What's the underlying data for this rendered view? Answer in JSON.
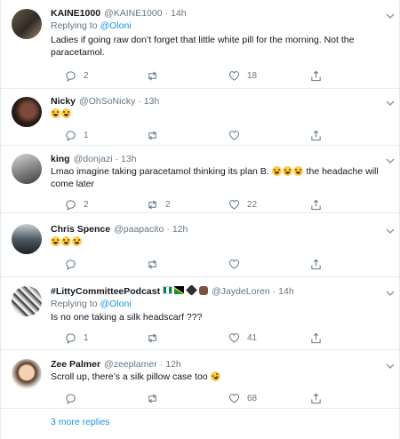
{
  "tweets": [
    {
      "name": "KAINE1000",
      "handle": "@KAINE1000",
      "time": "14h",
      "replying_label": "Replying to ",
      "replying_to": "@Oloni",
      "text": "Ladies if going raw don’t forget that little white pill for the morning. Not the paracetamol.",
      "replies": "2",
      "retweets": "",
      "likes": "18"
    },
    {
      "name": "Nicky",
      "handle": "@OhSoNicky",
      "time": "13h",
      "text": "",
      "emoji_count": 2,
      "replies": "1",
      "retweets": "",
      "likes": ""
    },
    {
      "name": "king",
      "handle": "@donjazi",
      "time": "13h",
      "text_before": "Lmao imagine taking paracetamol thinking its plan B. ",
      "text_after": " the headache will come later",
      "replies": "2",
      "retweets": "2",
      "likes": "22"
    },
    {
      "name": "Chris Spence",
      "handle": "@paapacito",
      "time": "12h",
      "replies": "",
      "retweets": "",
      "likes": ""
    },
    {
      "name": "#LittyCommitteePodcast",
      "handle": "@JaydeLoren",
      "time": "14h",
      "replying_label": "Replying to ",
      "replying_to": "@Oloni",
      "text": "Is no one taking a silk headscarf ???",
      "replies": "1",
      "retweets": "",
      "likes": "41"
    },
    {
      "name": "Zee Palmer",
      "handle": "@zeeplamer",
      "time": "12h",
      "text": "Scroll up, there’s a silk pillow case too ",
      "replies": "",
      "retweets": "",
      "likes": "68"
    }
  ],
  "more_replies": "3 more replies",
  "colors": {
    "link": "#1b95e0",
    "muted": "#657786",
    "border": "#e6ecf0"
  }
}
